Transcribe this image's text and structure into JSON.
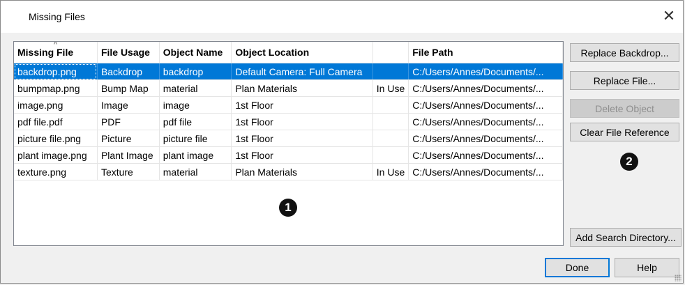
{
  "window": {
    "title": "Missing Files",
    "close_glyph": "✕"
  },
  "table": {
    "columns": [
      "Missing File",
      "File Usage",
      "Object Name",
      "Object Location",
      "",
      "File Path"
    ],
    "sort_indicator": "^",
    "rows": [
      [
        "backdrop.png",
        "Backdrop",
        "backdrop",
        "Default Camera: Full Camera",
        "",
        "C:/Users/Annes/Documents/..."
      ],
      [
        "bumpmap.png",
        "Bump Map",
        "material",
        "Plan Materials",
        "In Use",
        "C:/Users/Annes/Documents/..."
      ],
      [
        "image.png",
        "Image",
        "image",
        "1st Floor",
        "",
        "C:/Users/Annes/Documents/..."
      ],
      [
        "pdf file.pdf",
        "PDF",
        "pdf file",
        "1st Floor",
        "",
        "C:/Users/Annes/Documents/..."
      ],
      [
        "picture file.png",
        "Picture",
        "picture file",
        "1st Floor",
        "",
        "C:/Users/Annes/Documents/..."
      ],
      [
        "plant image.png",
        "Plant Image",
        "plant image",
        "1st Floor",
        "",
        "C:/Users/Annes/Documents/..."
      ],
      [
        "texture.png",
        "Texture",
        "material",
        "Plan Materials",
        "In Use",
        "C:/Users/Annes/Documents/..."
      ]
    ],
    "selected_row": 0
  },
  "buttons": {
    "replace_backdrop": "Replace Backdrop...",
    "replace_file": "Replace File...",
    "delete_object": "Delete Object",
    "clear_file_reference": "Clear File Reference",
    "add_search_directory": "Add Search Directory...",
    "done": "Done",
    "help": "Help"
  },
  "callouts": {
    "one": "1",
    "two": "2"
  },
  "colors": {
    "selection": "#0078d7",
    "default_button_border": "#0078d7"
  }
}
